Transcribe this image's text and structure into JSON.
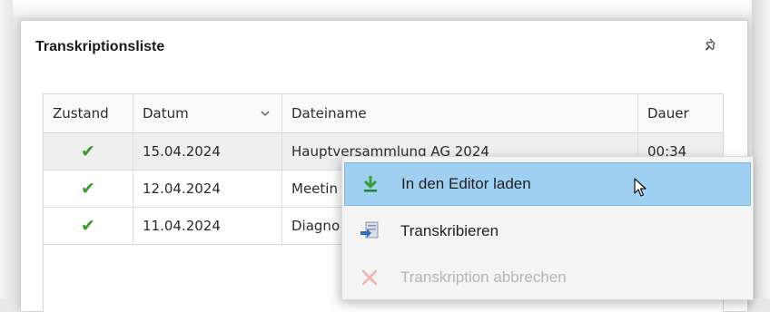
{
  "panel": {
    "title": "Transkriptionsliste",
    "pin_icon": "pin-icon"
  },
  "table": {
    "columns": [
      "Zustand",
      "Datum",
      "Dateiname",
      "Dauer"
    ],
    "rows": [
      {
        "status_icon": "check-icon",
        "date": "15.04.2024",
        "filename": "Hauptversammlung AG 2024",
        "duration": "00:34",
        "selected": true
      },
      {
        "status_icon": "check-icon",
        "date": "12.04.2024",
        "filename": "Meetin",
        "duration": "",
        "selected": false
      },
      {
        "status_icon": "check-icon",
        "date": "11.04.2024",
        "filename": "Diagno",
        "duration": "",
        "selected": false
      }
    ]
  },
  "context_menu": {
    "items": [
      {
        "label": "In den Editor laden",
        "icon": "load-into-editor-icon",
        "enabled": true,
        "highlighted": true
      },
      {
        "label": "Transkribieren",
        "icon": "transcribe-icon",
        "enabled": true,
        "highlighted": false
      },
      {
        "label": "Transkription abbrechen",
        "icon": "cancel-icon",
        "enabled": false,
        "highlighted": false
      }
    ]
  },
  "colors": {
    "highlight": "#9fd0f2",
    "check": "#3b9a2f",
    "disabled_text": "#b5b5b5"
  }
}
